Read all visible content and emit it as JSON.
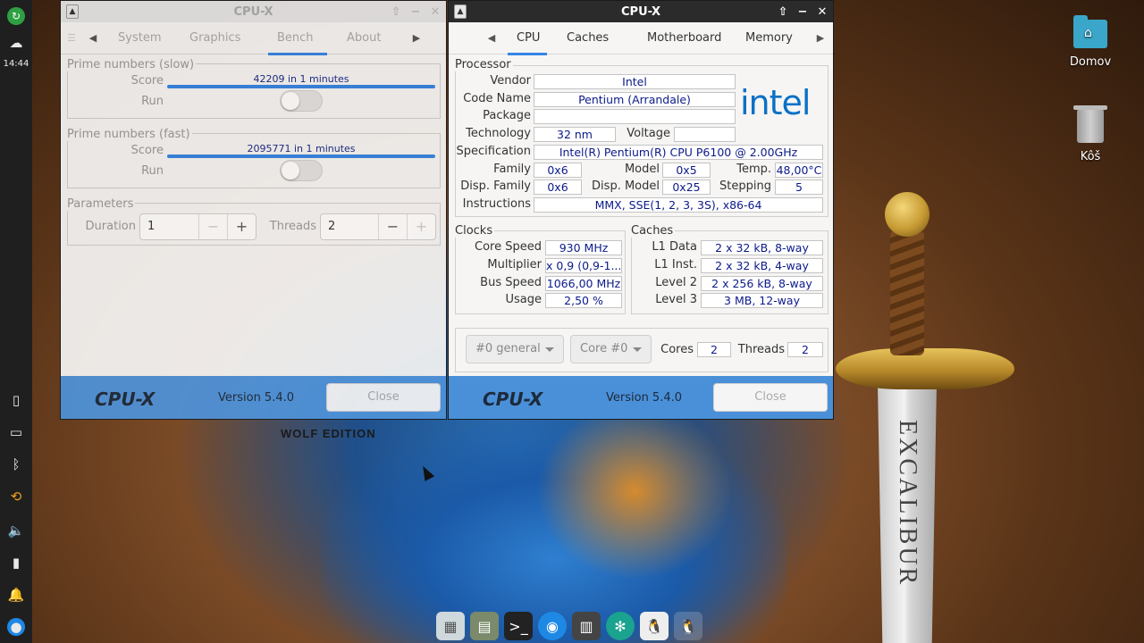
{
  "panel": {
    "clock": "14:44"
  },
  "desktop": {
    "icons": [
      {
        "label": "Domov"
      },
      {
        "label": "Kôš"
      }
    ]
  },
  "wallpaper": {
    "brand": "WOLF EDITION"
  },
  "sword": {
    "inscription": "EXCALIBUR"
  },
  "win_left": {
    "title": "CPU-X",
    "tabs": [
      "System",
      "Graphics",
      "Bench",
      "About"
    ],
    "selected_tab": "Bench",
    "prime_slow": {
      "label": "Prime numbers (slow)",
      "score_label": "Score",
      "score_value": "42209 in 1 minutes",
      "run_label": "Run"
    },
    "prime_fast": {
      "label": "Prime numbers (fast)",
      "score_label": "Score",
      "score_value": "2095771 in 1 minutes",
      "run_label": "Run"
    },
    "params": {
      "label": "Parameters",
      "duration_label": "Duration",
      "duration_value": "1",
      "threads_label": "Threads",
      "threads_value": "2"
    },
    "footer": {
      "logo": "CPU-X",
      "version": "Version 5.4.0",
      "close": "Close"
    }
  },
  "win_right": {
    "title": "CPU-X",
    "tabs": [
      "CPU",
      "Caches",
      "Motherboard",
      "Memory"
    ],
    "selected_tab": "CPU",
    "processor": {
      "label": "Processor",
      "vendor_label": "Vendor",
      "vendor": "Intel",
      "codename_label": "Code Name",
      "codename": "Pentium (Arrandale)",
      "package_label": "Package",
      "package": "",
      "technology_label": "Technology",
      "technology": "32 nm",
      "voltage_label": "Voltage",
      "voltage": "",
      "spec_label": "Specification",
      "spec": "Intel(R) Pentium(R) CPU      P6100  @ 2.00GHz",
      "family_label": "Family",
      "family": "0x6",
      "model_label": "Model",
      "model": "0x5",
      "temp_label": "Temp.",
      "temp": "48,00°C",
      "dfamily_label": "Disp. Family",
      "dfamily": "0x6",
      "dmodel_label": "Disp. Model",
      "dmodel": "0x25",
      "stepping_label": "Stepping",
      "stepping": "5",
      "instr_label": "Instructions",
      "instr": "MMX, SSE(1, 2, 3, 3S), x86-64",
      "logo_text": "intel"
    },
    "clocks": {
      "label": "Clocks",
      "core_label": "Core Speed",
      "core": "930 MHz",
      "mult_label": "Multiplier",
      "mult": "x 0,9 (0,9-1...",
      "bus_label": "Bus Speed",
      "bus": "1066,00 MHz",
      "usage_label": "Usage",
      "usage": "2,50 %"
    },
    "caches": {
      "label": "Caches",
      "l1d_label": "L1 Data",
      "l1d": "2 x   32 kB,  8-way",
      "l1i_label": "L1 Inst.",
      "l1i": "2 x   32 kB,  4-way",
      "l2_label": "Level 2",
      "l2": "2 x  256 kB,  8-way",
      "l3_label": "Level 3",
      "l3": "3 MB, 12-way"
    },
    "selectors": {
      "socket": "#0 general",
      "core": "Core #0",
      "cores_label": "Cores",
      "cores": "2",
      "threads_label": "Threads",
      "threads": "2"
    },
    "footer": {
      "logo": "CPU-X",
      "version": "Version 5.4.0",
      "close": "Close"
    }
  }
}
